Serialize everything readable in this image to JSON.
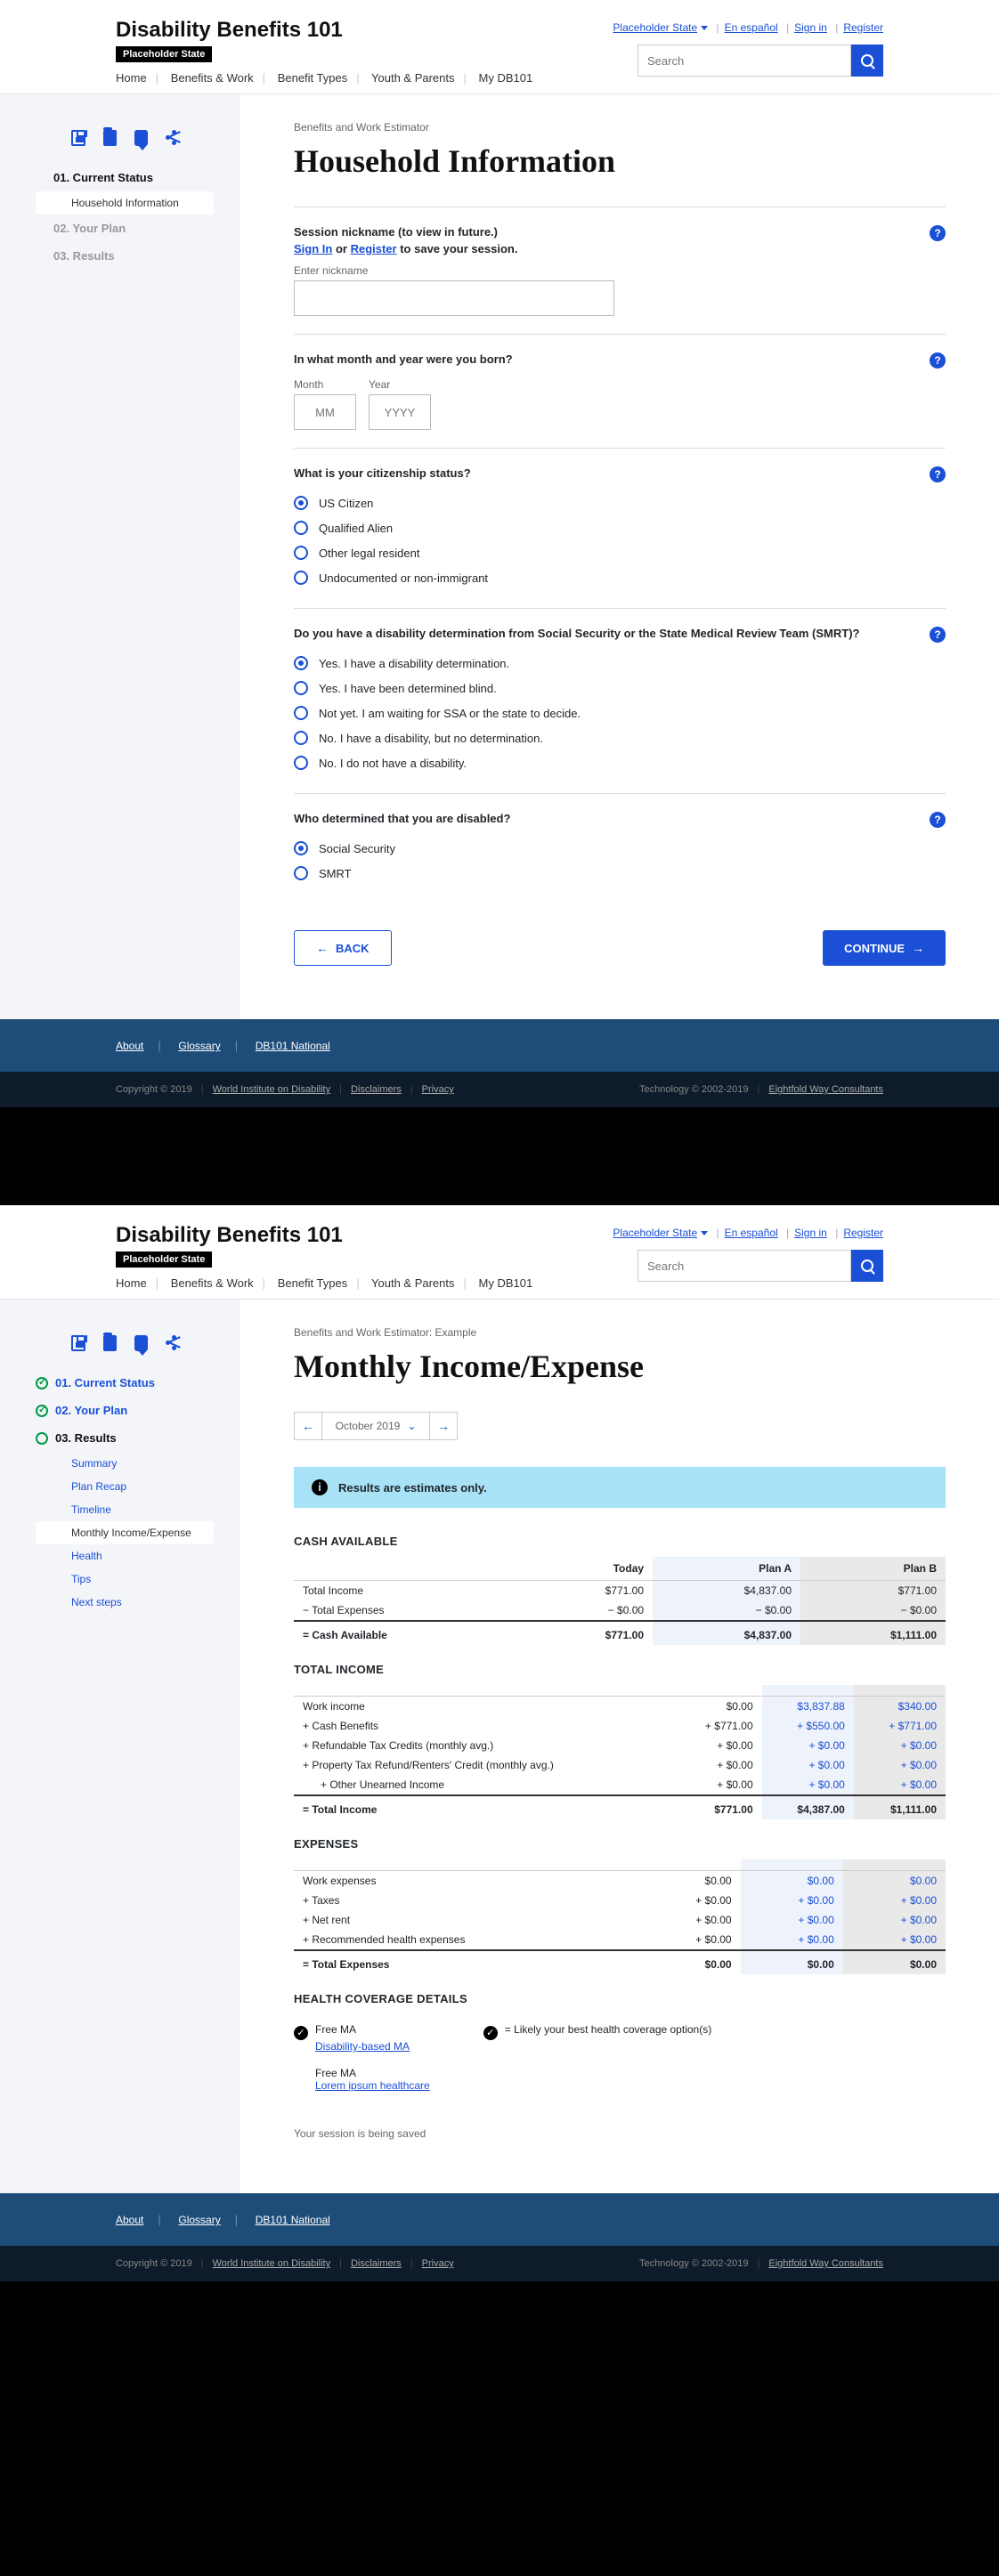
{
  "header": {
    "brand": "Disability Benefits 101",
    "tag": "Placeholder State",
    "links": {
      "state": "Placeholder State",
      "es": "En español",
      "signin": "Sign in",
      "register": "Register"
    },
    "search_ph": "Search",
    "nav": [
      "Home",
      "Benefits & Work",
      "Benefit Types",
      "Youth & Parents",
      "My DB101"
    ]
  },
  "p1": {
    "bc": "Benefits and Work Estimator",
    "title": "Household Information",
    "side": {
      "s1": "01. Current Status",
      "sub": "Household Information",
      "s2": "02. Your Plan",
      "s3": "03. Results"
    },
    "q1": {
      "l1": "Session nickname (to view in future.)",
      "l2a": "Sign In",
      "l2b": " or ",
      "l2c": "Register",
      "l2d": " to save your session.",
      "lbl": "Enter nickname"
    },
    "q2": {
      "t": "In what month and year were you born?",
      "m": "Month",
      "y": "Year",
      "mp": "MM",
      "yp": "YYYY"
    },
    "q3": {
      "t": "What is your citizenship status?",
      "o": [
        "US Citizen",
        "Qualified Alien",
        "Other legal resident",
        "Undocumented or non-immigrant"
      ]
    },
    "q4": {
      "t": "Do you have a disability determination from Social Security or the State Medical Review Team (SMRT)?",
      "o": [
        "Yes. I have a disability determination.",
        "Yes. I have been determined blind.",
        "Not yet. I am waiting for SSA or the state to decide.",
        "No. I have a disability, but no determination.",
        "No. I do not have a disability."
      ]
    },
    "q5": {
      "t": "Who determined that you are disabled?",
      "o": [
        "Social Security",
        "SMRT"
      ]
    },
    "back": "BACK",
    "cont": "CONTINUE"
  },
  "p2": {
    "bc": "Benefits and Work Estimator: Example",
    "title": "Monthly Income/Expense",
    "month": "October 2019",
    "side": {
      "s1": "01. Current Status",
      "s2": "02. Your Plan",
      "s3": "03. Results",
      "subs": [
        "Summary",
        "Plan Recap",
        "Timeline",
        "Monthly Income/Expense",
        "Health",
        "Tips",
        "Next steps"
      ]
    },
    "info": "Results are estimates only.",
    "cols": [
      "Today",
      "Plan A",
      "Plan B"
    ],
    "cash": {
      "h": "CASH AVAILABLE",
      "r1": "Total Income",
      "r2": "− Total Expenses",
      "tot": "= Cash Available",
      "v": [
        [
          "$771.00",
          "$4,837.00",
          "$771.00"
        ],
        [
          "− $0.00",
          "− $0.00",
          "− $0.00"
        ],
        [
          "$771.00",
          "$4,837.00",
          "$1,111.00"
        ]
      ]
    },
    "inc": {
      "h": "TOTAL INCOME",
      "rows": [
        "Work income",
        "+ Cash Benefits",
        "+ Refundable Tax Credits (monthly avg.)",
        "+ Property Tax Refund/Renters' Credit (monthly avg.)",
        "    + Other Unearned Income"
      ],
      "tot": "= Total Income",
      "v": [
        [
          "$0.00",
          "$3,837.88",
          "$340.00"
        ],
        [
          "+ $771.00",
          "+ $550.00",
          "+ $771.00"
        ],
        [
          "+ $0.00",
          "+ $0.00",
          "+ $0.00"
        ],
        [
          "+ $0.00",
          "+ $0.00",
          "+ $0.00"
        ],
        [
          "+ $0.00",
          "+ $0.00",
          "+ $0.00"
        ],
        [
          "$771.00",
          "$4,387.00",
          "$1,111.00"
        ]
      ]
    },
    "exp": {
      "h": "EXPENSES",
      "rows": [
        "Work expenses",
        "+ Taxes",
        "+ Net rent",
        "+ Recommended health expenses"
      ],
      "tot": "= Total Expenses",
      "v": [
        [
          "$0.00",
          "$0.00",
          "$0.00"
        ],
        [
          "+ $0.00",
          "+ $0.00",
          "+ $0.00"
        ],
        [
          "+ $0.00",
          "+ $0.00",
          "+ $0.00"
        ],
        [
          "+ $0.00",
          "+ $0.00",
          "+ $0.00"
        ],
        [
          "$0.00",
          "$0.00",
          "$0.00"
        ]
      ]
    },
    "hc": {
      "h": "HEALTH COVERAGE DETAILS",
      "l1": "Free MA",
      "l1b": "Disability-based MA",
      "r": "=  Likely your best health coverage option(s)",
      "l2": "Free MA",
      "l2b": "Lorem ipsum healthcare"
    },
    "saving": "Your session is being saved"
  },
  "footer": {
    "a": "About",
    "g": "Glossary",
    "n": "DB101 National",
    "c": "Copyright © 2019",
    "w": "World Institute on Disability",
    "d": "Disclaimers",
    "p": "Privacy",
    "t": "Technology © 2002-2019",
    "e": "Eightfold Way Consultants"
  }
}
